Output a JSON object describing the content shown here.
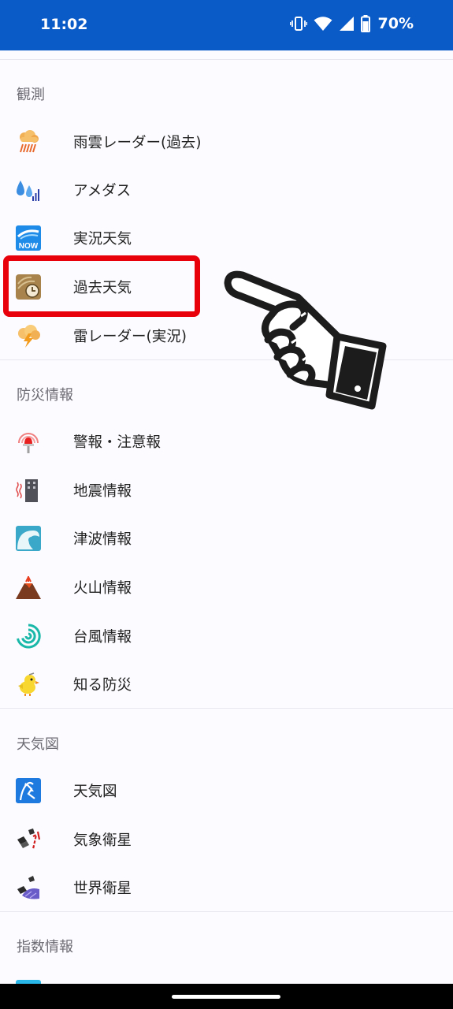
{
  "status_bar": {
    "time": "11:02",
    "battery": "70%"
  },
  "sections": [
    {
      "header": "観測",
      "items": [
        {
          "label": "雨雲レーダー(過去)",
          "icon": "rain-cloud-icon"
        },
        {
          "label": "アメダス",
          "icon": "amedas-raindrop-icon"
        },
        {
          "label": "実況天気",
          "icon": "now-weather-icon",
          "icon_text": "NOW"
        },
        {
          "label": "過去天気",
          "icon": "past-weather-icon"
        },
        {
          "label": "雷レーダー(実況)",
          "icon": "lightning-icon"
        }
      ]
    },
    {
      "header": "防災情報",
      "items": [
        {
          "label": "警報・注意報",
          "icon": "warning-beacon-icon"
        },
        {
          "label": "地震情報",
          "icon": "earthquake-building-icon"
        },
        {
          "label": "津波情報",
          "icon": "tsunami-wave-icon"
        },
        {
          "label": "火山情報",
          "icon": "volcano-icon"
        },
        {
          "label": "台風情報",
          "icon": "typhoon-icon"
        },
        {
          "label": "知る防災",
          "icon": "bird-mascot-icon"
        }
      ]
    },
    {
      "header": "天気図",
      "items": [
        {
          "label": "天気図",
          "icon": "weather-map-icon"
        },
        {
          "label": "気象衛星",
          "icon": "weather-satellite-icon"
        },
        {
          "label": "世界衛星",
          "icon": "world-satellite-icon"
        }
      ]
    },
    {
      "header": "指数情報",
      "items": []
    }
  ],
  "colors": {
    "status_bar": "#0a5ac8",
    "highlight": "#e8000b"
  }
}
